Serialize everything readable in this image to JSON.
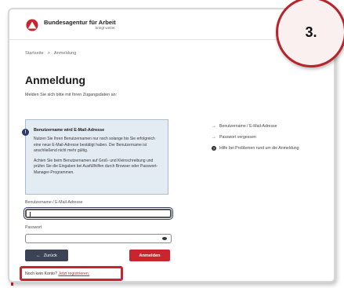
{
  "brand": {
    "name": "Bundesagentur für Arbeit",
    "tagline": "bringt weiter.",
    "color": "#c8252f"
  },
  "step_badge": "3.",
  "breadcrumb": {
    "items": [
      "Startseite",
      "Anmeldung"
    ],
    "separator": ">"
  },
  "page": {
    "title": "Anmeldung",
    "subtitle": "Melden Sie sich bitte mit Ihren Zugangsdaten an:"
  },
  "info_box": {
    "icon": "info-icon",
    "heading": "Benutzername wird E-Mail-Adresse",
    "paragraph1": "Nutzen Sie Ihren Benutzernamen nur noch solange bis Sie erfolgreich eine neue E-Mail-Adresse bestätigt haben. Der Benutzername ist anschließend nicht mehr gültig.",
    "paragraph2": "Achten Sie beim Benutzernamen auf Groß- und Kleinschreibung und prüfen Sie die Eingaben bei Ausfüllhilfen durch Browser oder Passwort-Manager-Programmen."
  },
  "side_links": [
    {
      "label": "Benutzername / E-Mail-Adresse",
      "icon": "arrow-right-icon"
    },
    {
      "label": "Passwort vergessen",
      "icon": "arrow-right-icon"
    },
    {
      "label": "Hilfe bei Problemen rund um die Anmeldung",
      "icon": "question-icon"
    }
  ],
  "form": {
    "username_label": "Benutzername / E-Mail-Adresse",
    "username_value": "",
    "password_label": "Passwort",
    "password_value": ""
  },
  "buttons": {
    "back_label": "Zurück",
    "back_arrow": "←",
    "login_label": "Anmelden"
  },
  "register": {
    "text": "Noch kein Konto?",
    "link": "Jetzt registrieren."
  }
}
